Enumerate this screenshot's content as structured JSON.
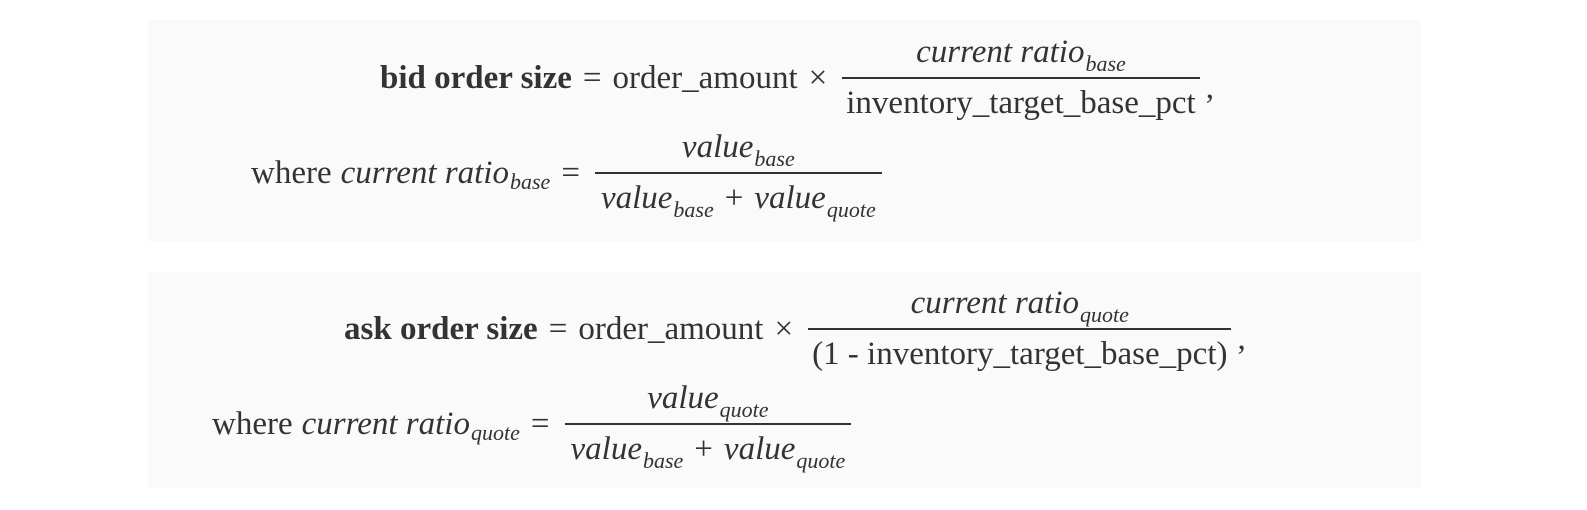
{
  "bid": {
    "lhs": "bid order size",
    "equals": "=",
    "factor": "order_amount",
    "times": "×",
    "num_main": "current ratio",
    "num_sub": "base",
    "den": "inventory_target_base_pct",
    "comma": ",",
    "where_word": "where",
    "where_main": "current ratio",
    "where_sub": "base",
    "where_equals": "=",
    "w_num_main": "value",
    "w_num_sub": "base",
    "w_den_a_main": "value",
    "w_den_a_sub": "base",
    "w_den_plus": "+",
    "w_den_b_main": "value",
    "w_den_b_sub": "quote"
  },
  "ask": {
    "lhs": "ask order size",
    "equals": "=",
    "factor": "order_amount",
    "times": "×",
    "num_main": "current ratio",
    "num_sub": "quote",
    "den": "(1 - inventory_target_base_pct)",
    "comma": ",",
    "where_word": "where",
    "where_main": "current ratio",
    "where_sub": "quote",
    "where_equals": "=",
    "w_num_main": "value",
    "w_num_sub": "quote",
    "w_den_a_main": "value",
    "w_den_a_sub": "base",
    "w_den_plus": "+",
    "w_den_b_main": "value",
    "w_den_b_sub": "quote"
  }
}
